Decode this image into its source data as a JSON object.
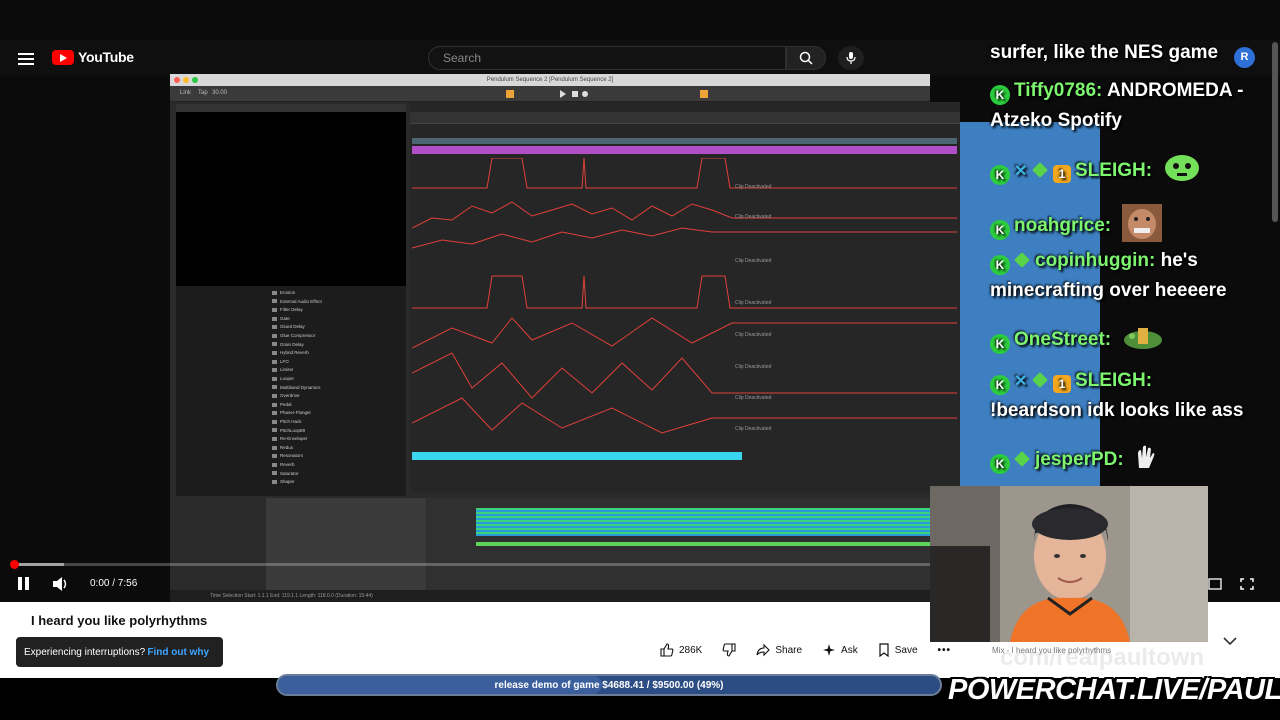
{
  "youtube": {
    "logo_text": "YouTube",
    "search_placeholder": "Search",
    "avatar_letter": "R"
  },
  "daw": {
    "window_title": "Pendulum Sequence 2 [Pendulum Sequence 2]",
    "clip_label": "Clip Deactivated",
    "devices": [
      "Erosion",
      "External Audio Effect",
      "Filter Delay",
      "Gate",
      "Glued Delay",
      "Glue Compressor",
      "Grain Delay",
      "Hybrid Reverb",
      "LFO",
      "Limiter",
      "Looper",
      "Multiband Dynamics",
      "Overdrive",
      "Pedal",
      "Phaser-Flanger",
      "Pitch Hack",
      "PitchLoop89",
      "Re-Enveloper",
      "Redux",
      "Resonators",
      "Reverb",
      "Saturator",
      "Shaper"
    ],
    "status_text": "Time Selection  Start: 1.1.1   End: 119.1.1   Length: 118.0.0  (Duration: 15:44)"
  },
  "player": {
    "time": "0:00 / 7:56",
    "progress_fraction": 0.0
  },
  "chat": {
    "messages": [
      {
        "user": "",
        "text": "surfer, like the NES game"
      },
      {
        "user": "Tiffy0786:",
        "text": "ANDROMEDA -"
      },
      {
        "user": "",
        "text": "Atzeko Spotify"
      },
      {
        "user": "SLEIGH:",
        "text": ""
      },
      {
        "user": "noahgrice:",
        "text": ""
      },
      {
        "user": "copinhuggin:",
        "text": "he's"
      },
      {
        "user": "",
        "text": "minecrafting over heeeere"
      },
      {
        "user": "OneStreet:",
        "text": ""
      },
      {
        "user": "SLEIGH:",
        "text": ""
      },
      {
        "user": "",
        "text": "!beardson idk looks like ass"
      },
      {
        "user": "jesperPD:",
        "text": ""
      }
    ]
  },
  "video": {
    "title": "I heard you like polyrhythms",
    "interruptions_text": "Experiencing interruptions?",
    "find_out_why": "Find out why",
    "likes": "286K",
    "share": "Share",
    "ask": "Ask",
    "save": "Save",
    "mix_label": "Mix - I heard you like polyrhythms"
  },
  "overlay": {
    "donation_text": "release demo of game $4688.41 / $9500.00 (49%)",
    "donation_fraction": 0.49,
    "powerchat": "POWERCHAT.LIVE/PAULTOWN"
  }
}
